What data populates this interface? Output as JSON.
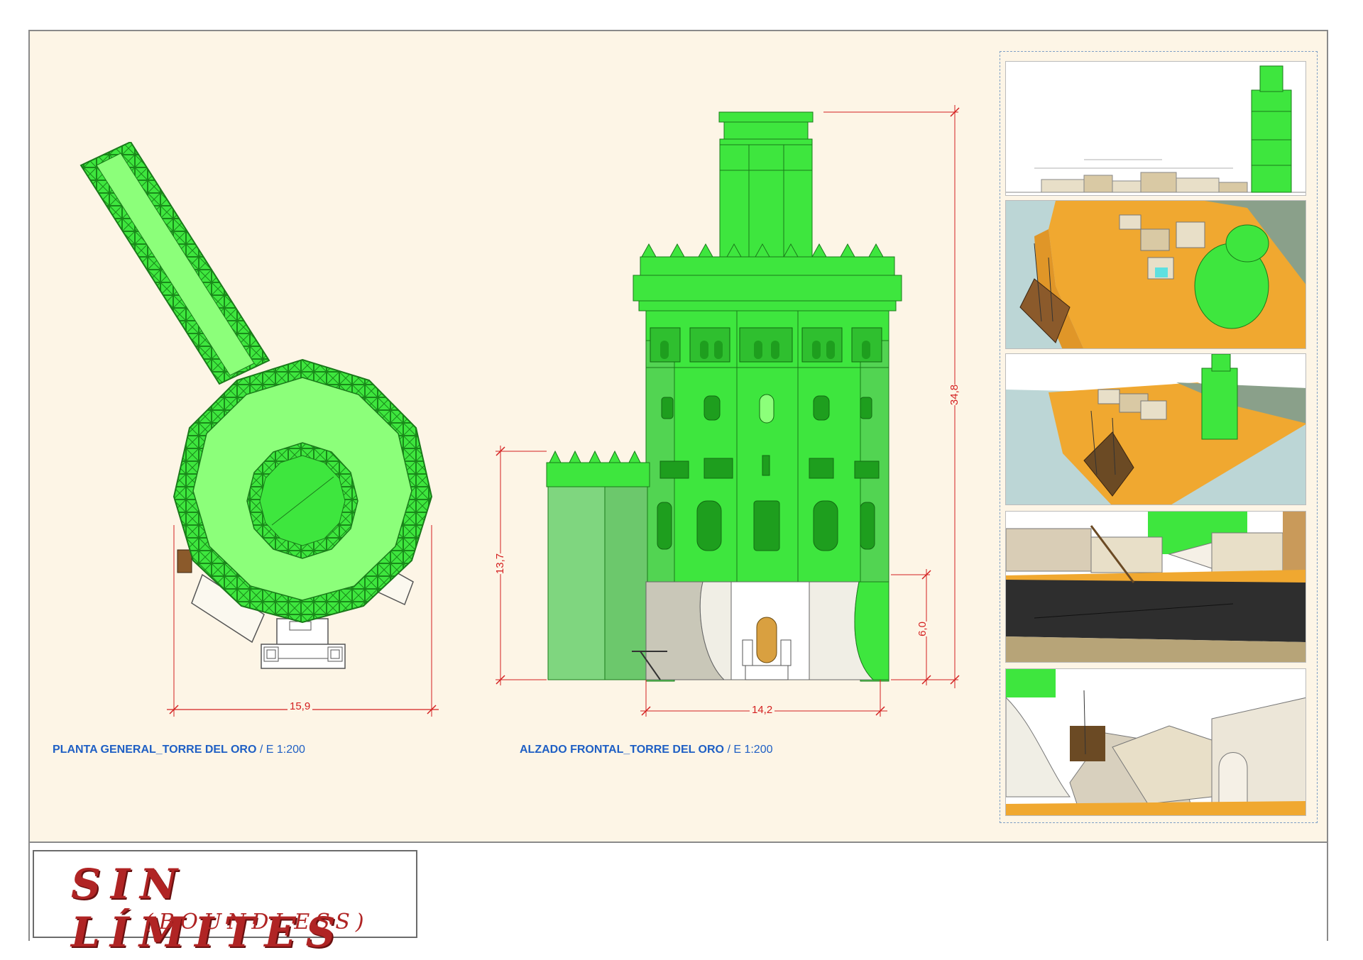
{
  "plan": {
    "caption": "PLANTA GENERAL_TORRE DEL ORO",
    "scale": " / E 1:200",
    "dim_width": "15,9"
  },
  "elevation": {
    "caption": "ALZADO FRONTAL_TORRE DEL ORO",
    "scale": " / E 1:200",
    "dim_height_total": "34,8",
    "dim_height_wall": "13,7",
    "dim_height_base": "6,0",
    "dim_width": "14,2"
  },
  "logo": {
    "main": "SIN LÍMITES",
    "sub": "(BOUNDLESS)"
  },
  "colors": {
    "tower_green": "#3ee63e",
    "light_green": "#8cff7a",
    "dimension_red": "#d42020",
    "caption_blue": "#1f5fc4",
    "sand": "#f0a830",
    "background": "#fdf5e6"
  }
}
